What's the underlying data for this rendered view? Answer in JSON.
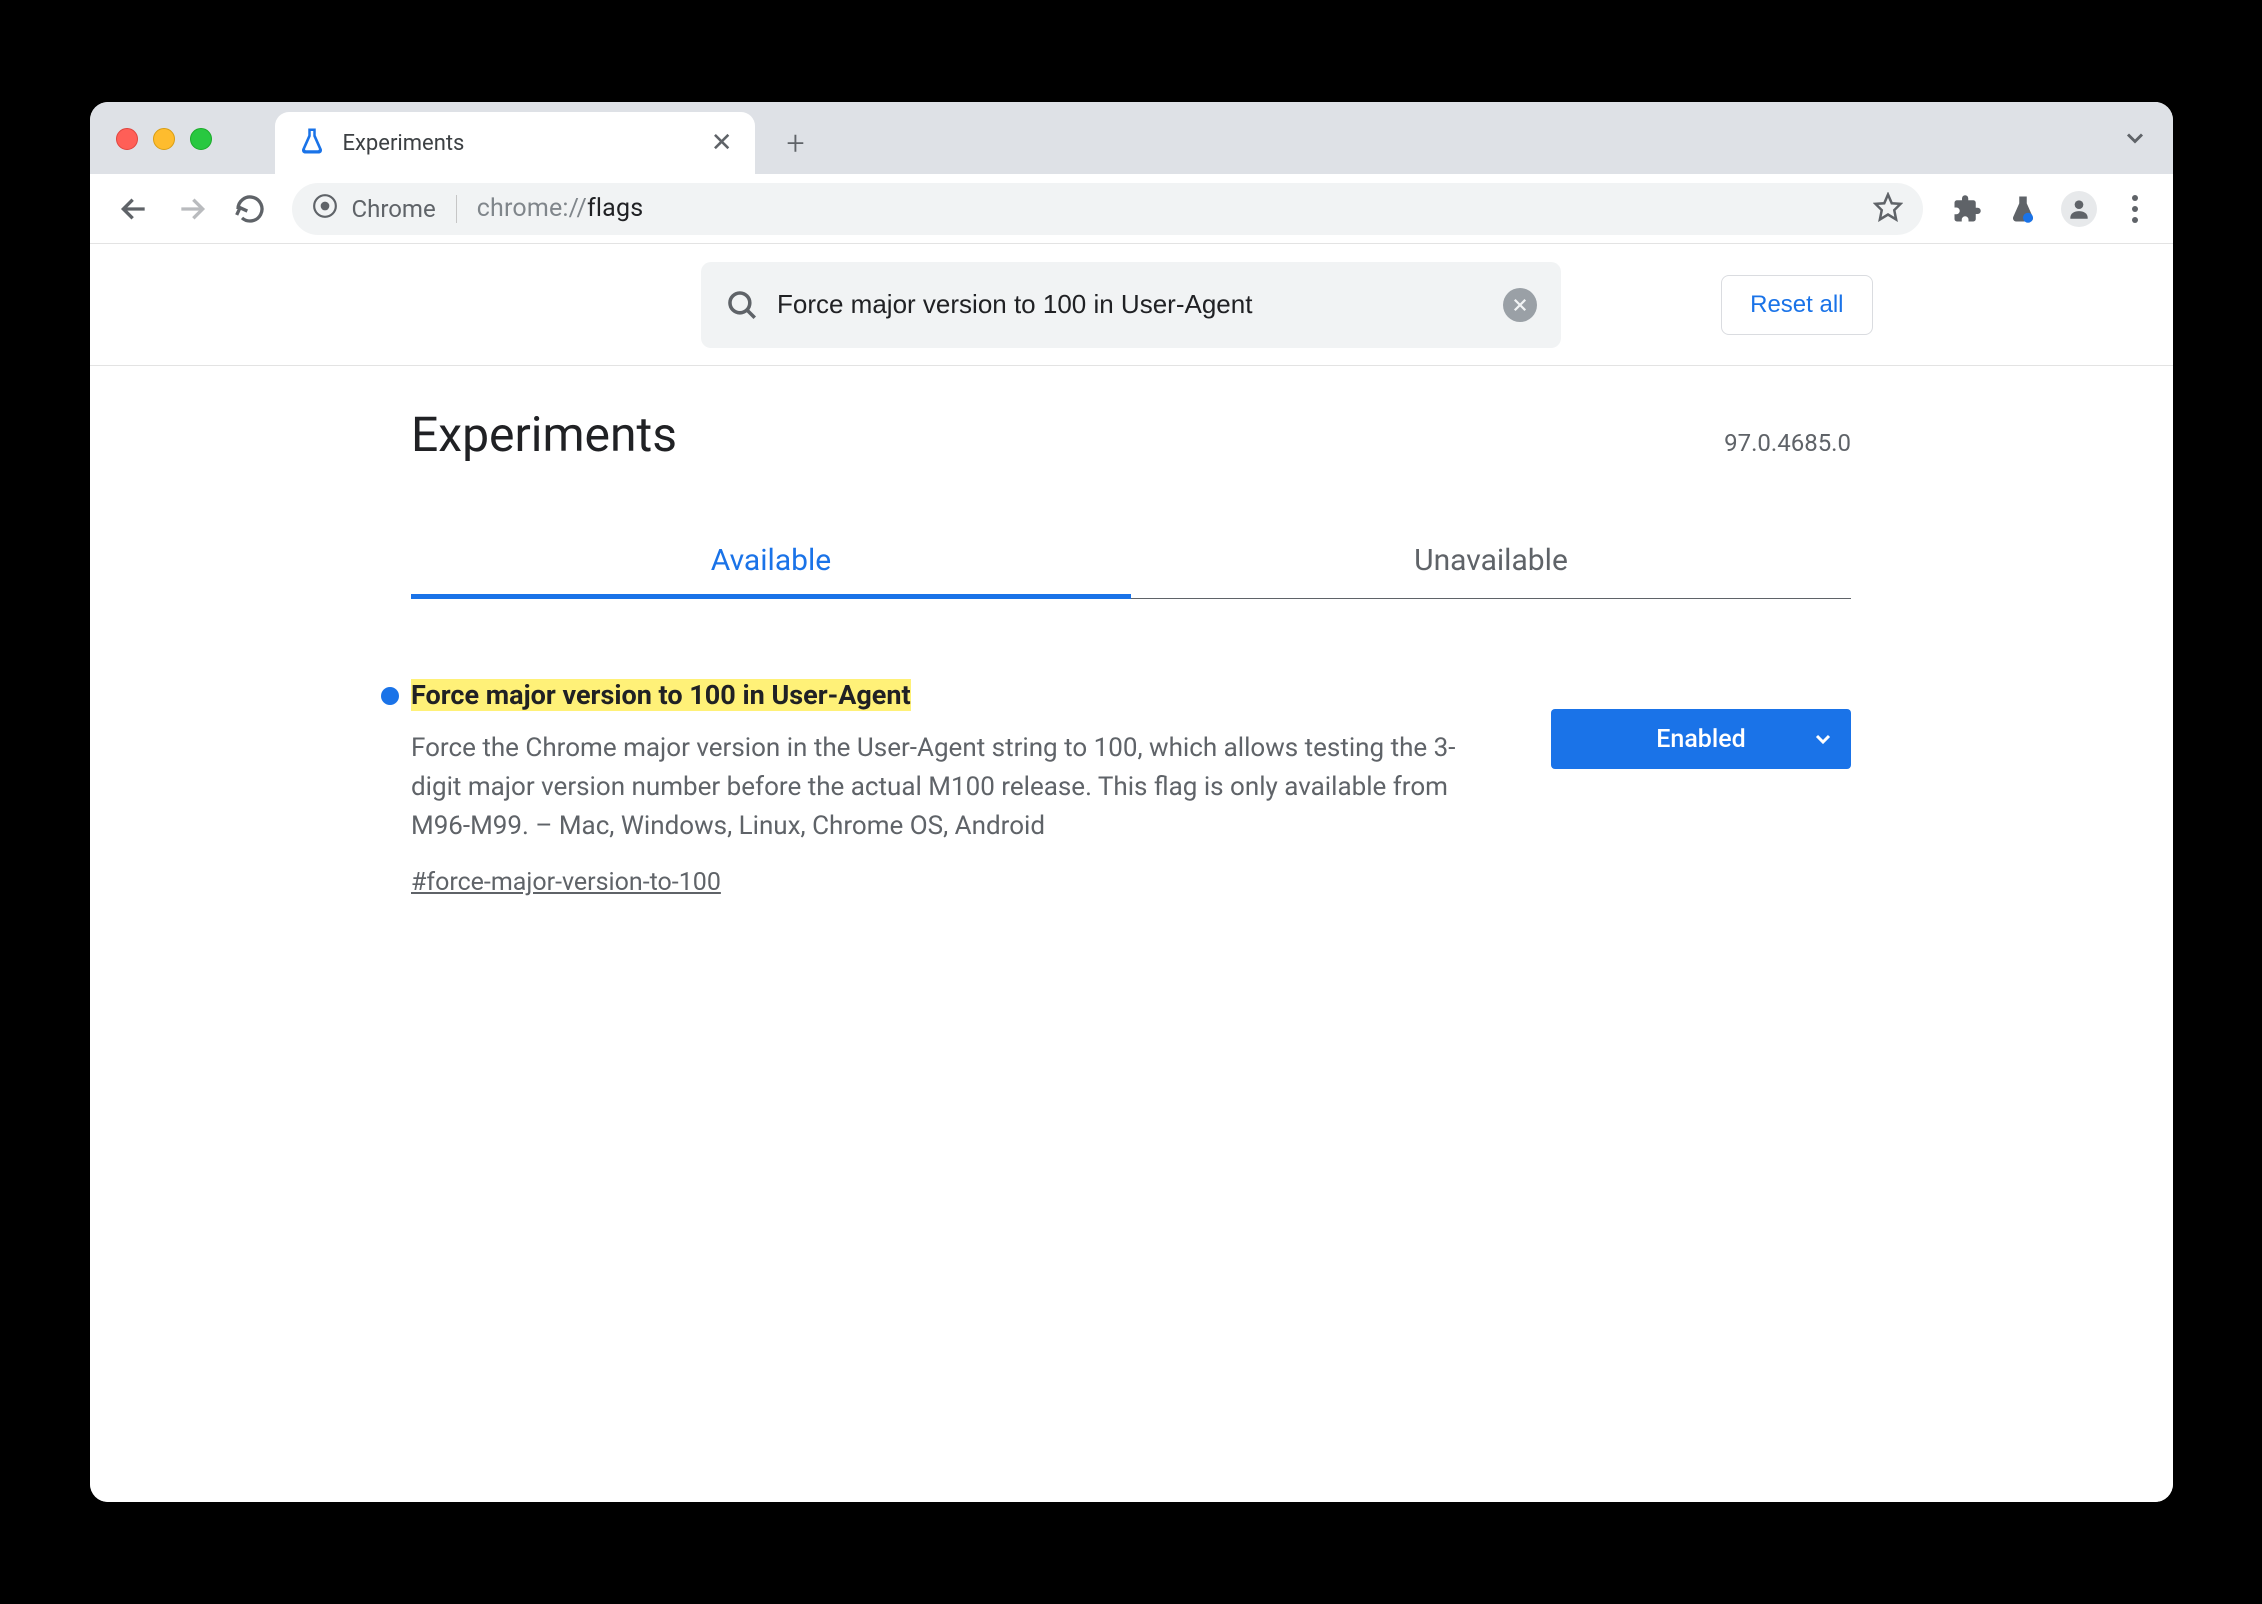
{
  "window": {
    "tab_title": "Experiments",
    "address_chip_label": "Chrome",
    "address_url_prefix": "chrome://",
    "address_url_path": "flags"
  },
  "page": {
    "search_value": "Force major version to 100 in User-Agent",
    "reset_label": "Reset all",
    "heading": "Experiments",
    "version": "97.0.4685.0",
    "tabs": {
      "available": "Available",
      "unavailable": "Unavailable",
      "active": "available"
    }
  },
  "flag": {
    "title": "Force major version to 100 in User-Agent",
    "description": "Force the Chrome major version in the User-Agent string to 100, which allows testing the 3-digit major version number before the actual M100 release. This flag is only available from M96-M99. – Mac, Windows, Linux, Chrome OS, Android",
    "anchor": "#force-major-version-to-100",
    "select_value": "Enabled"
  },
  "colors": {
    "accent": "#1a73e8",
    "highlight": "#fff178"
  }
}
